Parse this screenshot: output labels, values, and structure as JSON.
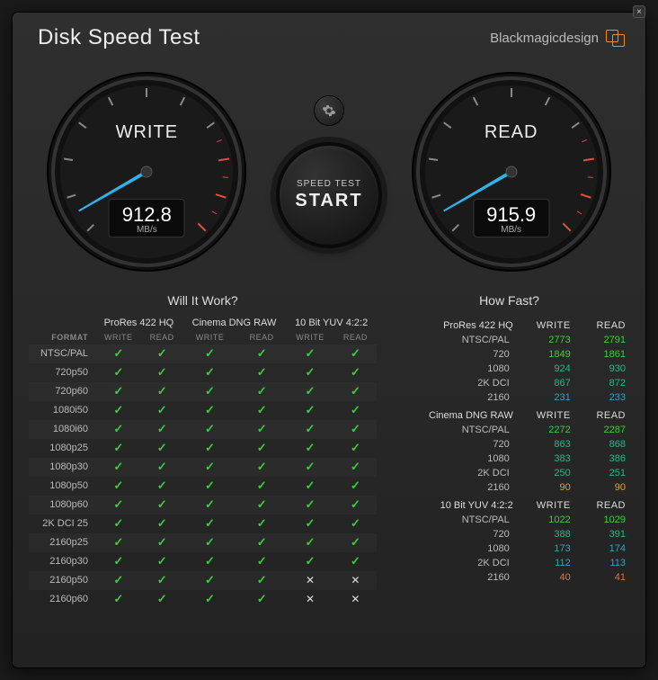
{
  "header": {
    "title": "Disk Speed Test",
    "brand": "Blackmagicdesign"
  },
  "gauges": {
    "write": {
      "label": "WRITE",
      "value": "912.8",
      "unit": "MB/s"
    },
    "read": {
      "label": "READ",
      "value": "915.9",
      "unit": "MB/s"
    }
  },
  "start_button": {
    "small": "SPEED TEST",
    "big": "START"
  },
  "will_it_work": {
    "title": "Will It Work?",
    "format_header": "FORMAT",
    "sub_write": "WRITE",
    "sub_read": "READ",
    "codecs": [
      "ProRes 422 HQ",
      "Cinema DNG RAW",
      "10 Bit YUV 4:2:2"
    ],
    "rows": [
      {
        "label": "NTSC/PAL",
        "vals": [
          "y",
          "y",
          "y",
          "y",
          "y",
          "y"
        ]
      },
      {
        "label": "720p50",
        "vals": [
          "y",
          "y",
          "y",
          "y",
          "y",
          "y"
        ]
      },
      {
        "label": "720p60",
        "vals": [
          "y",
          "y",
          "y",
          "y",
          "y",
          "y"
        ]
      },
      {
        "label": "1080i50",
        "vals": [
          "y",
          "y",
          "y",
          "y",
          "y",
          "y"
        ]
      },
      {
        "label": "1080i60",
        "vals": [
          "y",
          "y",
          "y",
          "y",
          "y",
          "y"
        ]
      },
      {
        "label": "1080p25",
        "vals": [
          "y",
          "y",
          "y",
          "y",
          "y",
          "y"
        ]
      },
      {
        "label": "1080p30",
        "vals": [
          "y",
          "y",
          "y",
          "y",
          "y",
          "y"
        ]
      },
      {
        "label": "1080p50",
        "vals": [
          "y",
          "y",
          "y",
          "y",
          "y",
          "y"
        ]
      },
      {
        "label": "1080p60",
        "vals": [
          "y",
          "y",
          "y",
          "y",
          "y",
          "y"
        ]
      },
      {
        "label": "2K DCI 25",
        "vals": [
          "y",
          "y",
          "y",
          "y",
          "y",
          "y"
        ]
      },
      {
        "label": "2160p25",
        "vals": [
          "y",
          "y",
          "y",
          "y",
          "y",
          "y"
        ]
      },
      {
        "label": "2160p30",
        "vals": [
          "y",
          "y",
          "y",
          "y",
          "y",
          "y"
        ]
      },
      {
        "label": "2160p50",
        "vals": [
          "y",
          "y",
          "y",
          "y",
          "n",
          "n"
        ]
      },
      {
        "label": "2160p60",
        "vals": [
          "y",
          "y",
          "y",
          "y",
          "n",
          "n"
        ]
      }
    ]
  },
  "how_fast": {
    "title": "How Fast?",
    "sub_write": "WRITE",
    "sub_read": "READ",
    "sections": [
      {
        "name": "ProRes 422 HQ",
        "rows": [
          {
            "label": "NTSC/PAL",
            "w": "2773",
            "r": "2791",
            "cls": "num-green"
          },
          {
            "label": "720",
            "w": "1849",
            "r": "1861",
            "cls": "num-green"
          },
          {
            "label": "1080",
            "w": "924",
            "r": "930",
            "cls": "num-teal"
          },
          {
            "label": "2K DCI",
            "w": "867",
            "r": "872",
            "cls": "num-teal"
          },
          {
            "label": "2160",
            "w": "231",
            "r": "233",
            "cls": "num-blue"
          }
        ]
      },
      {
        "name": "Cinema DNG RAW",
        "rows": [
          {
            "label": "NTSC/PAL",
            "w": "2272",
            "r": "2287",
            "cls": "num-green"
          },
          {
            "label": "720",
            "w": "863",
            "r": "868",
            "cls": "num-teal"
          },
          {
            "label": "1080",
            "w": "383",
            "r": "386",
            "cls": "num-teal"
          },
          {
            "label": "2K DCI",
            "w": "250",
            "r": "251",
            "cls": "num-teal"
          },
          {
            "label": "2160",
            "w": "90",
            "r": "90",
            "cls": "num-amber"
          }
        ]
      },
      {
        "name": "10 Bit YUV 4:2:2",
        "rows": [
          {
            "label": "NTSC/PAL",
            "w": "1022",
            "r": "1029",
            "cls": "num-green"
          },
          {
            "label": "720",
            "w": "388",
            "r": "391",
            "cls": "num-teal"
          },
          {
            "label": "1080",
            "w": "173",
            "r": "174",
            "cls": "num-blue"
          },
          {
            "label": "2K DCI",
            "w": "112",
            "r": "113",
            "cls": "num-blue"
          },
          {
            "label": "2160",
            "w": "40",
            "r": "41",
            "cls": "num-orange"
          }
        ]
      }
    ]
  }
}
